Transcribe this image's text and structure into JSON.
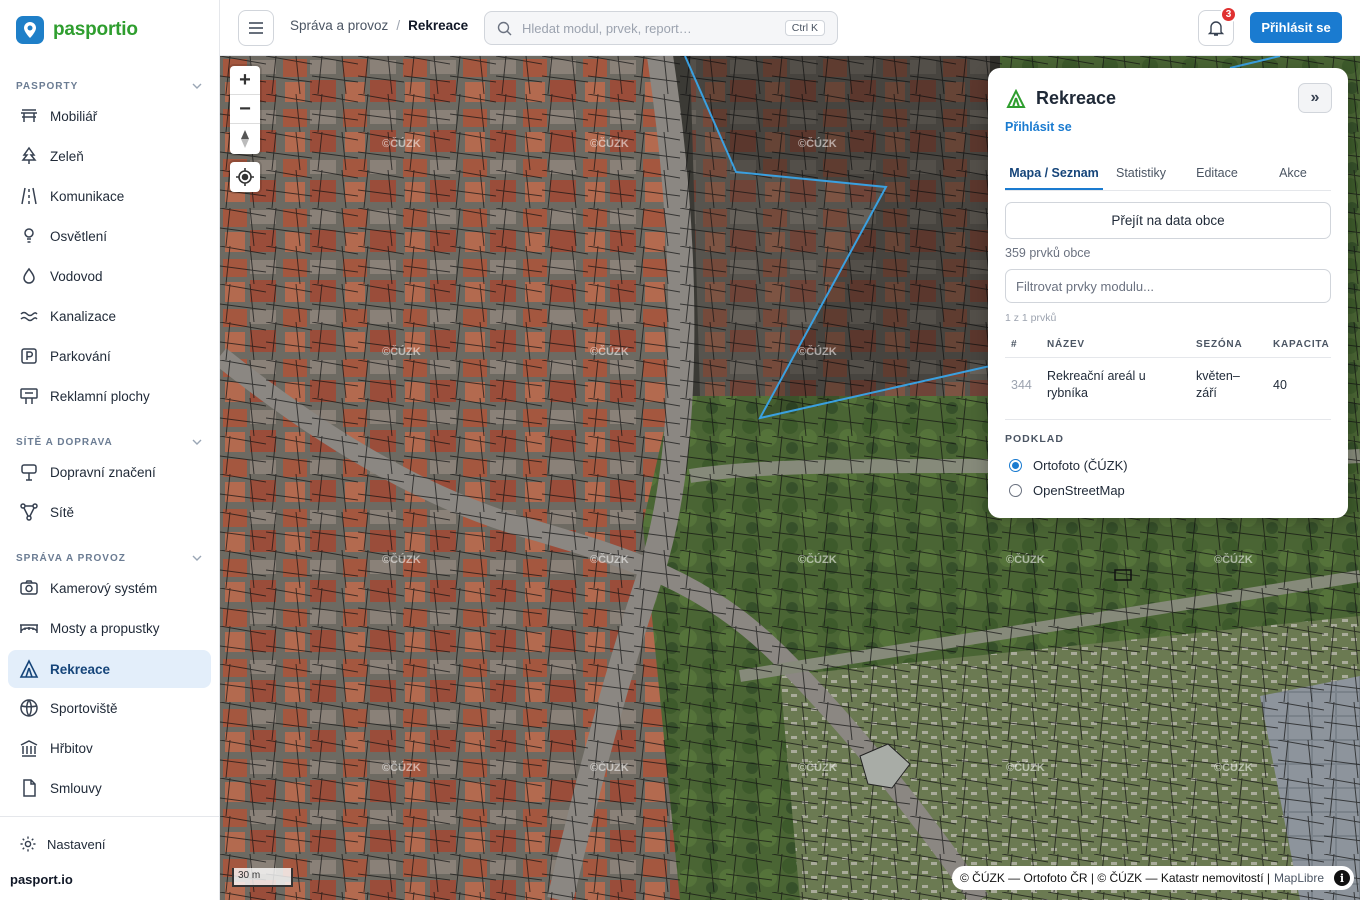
{
  "brand": {
    "name": "pasportio",
    "footer": "pasport.io"
  },
  "sidebar": {
    "sections": [
      {
        "title": "PASPORTY",
        "items": [
          {
            "label": "Mobiliář",
            "icon": "bench-icon"
          },
          {
            "label": "Zeleň",
            "icon": "tree-icon"
          },
          {
            "label": "Komunikace",
            "icon": "road-icon"
          },
          {
            "label": "Osvětlení",
            "icon": "lamp-icon"
          },
          {
            "label": "Vodovod",
            "icon": "droplet-icon"
          },
          {
            "label": "Kanalizace",
            "icon": "waves-icon"
          },
          {
            "label": "Parkování",
            "icon": "parking-icon"
          },
          {
            "label": "Reklamní plochy",
            "icon": "billboard-icon"
          }
        ]
      },
      {
        "title": "SÍTĚ A DOPRAVA",
        "items": [
          {
            "label": "Dopravní značení",
            "icon": "sign-icon"
          },
          {
            "label": "Sítě",
            "icon": "network-icon"
          }
        ]
      },
      {
        "title": "SPRÁVA A PROVOZ",
        "items": [
          {
            "label": "Kamerový systém",
            "icon": "camera-icon"
          },
          {
            "label": "Mosty a propustky",
            "icon": "bridge-icon"
          },
          {
            "label": "Rekreace",
            "icon": "tent-icon",
            "active": true
          },
          {
            "label": "Sportoviště",
            "icon": "ball-icon"
          },
          {
            "label": "Hřbitov",
            "icon": "landmark-icon"
          },
          {
            "label": "Smlouvy",
            "icon": "document-icon"
          }
        ]
      }
    ],
    "settings_label": "Nastavení"
  },
  "header": {
    "breadcrumb": {
      "parent": "Správa a provoz",
      "separator": "/",
      "current": "Rekreace"
    },
    "search": {
      "placeholder": "Hledat modul, prvek, report…",
      "shortcut": "Ctrl K"
    },
    "notifications": {
      "count": "3"
    },
    "login_label": "Přihlásit se"
  },
  "map": {
    "scale_label": "30 m",
    "attribution": "© ČÚZK — Ortofoto ČR | © ČÚZK — Katastr nemovitostí |",
    "attribution_lib": "MapLibre",
    "info_label": "i",
    "watermark": "©ČÚZK",
    "zoom_in": "+",
    "zoom_out": "−",
    "compass": "↑"
  },
  "panel": {
    "title": "Rekreace",
    "collapse_label": "»",
    "login_link": "Přihlásit se",
    "tabs": [
      "Mapa / Seznam",
      "Statistiky",
      "Editace",
      "Akce"
    ],
    "goto_button": "Přejít na data obce",
    "count_text": "359 prvků obce",
    "filter_placeholder": "Filtrovat prvky modulu...",
    "results_text": "1 z 1 prvků",
    "table": {
      "headers": [
        "#",
        "NÁZEV",
        "SEZÓNA",
        "KAPACITA"
      ],
      "rows": [
        {
          "id": "344",
          "name": "Rekreační areál u rybníka",
          "season": "květen–září",
          "capacity": "40"
        }
      ]
    },
    "basemap": {
      "title": "PODKLAD",
      "options": [
        {
          "label": "Ortofoto (ČÚZK)",
          "selected": true
        },
        {
          "label": "OpenStreetMap",
          "selected": false
        }
      ]
    }
  },
  "colors": {
    "accent": "#1a7bd0",
    "brand_green": "#2f9e2f",
    "active_bg": "#e3eefa",
    "badge": "#e03131",
    "polygon": "#3aa0e0"
  }
}
